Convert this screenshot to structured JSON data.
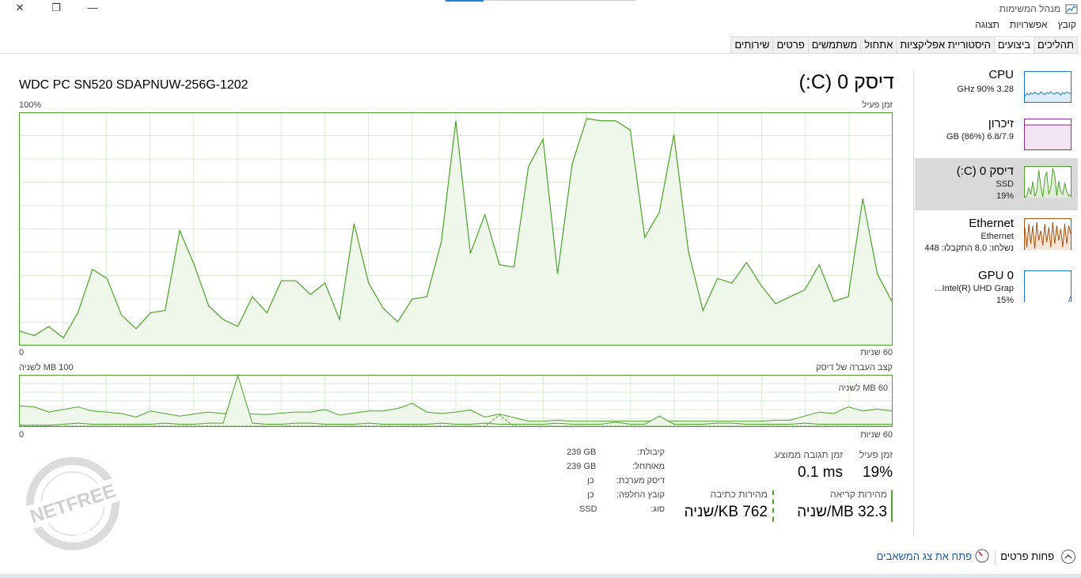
{
  "window": {
    "title": "מנהל המשימות",
    "controls": {
      "minimize": "—",
      "restore": "❐",
      "close": "✕"
    }
  },
  "menu": [
    "קובץ",
    "אפשרויות",
    "תצוגה"
  ],
  "tabs": [
    "תהליכים",
    "ביצועים",
    "היסטוריית אפליקציות",
    "אתחול",
    "משתמשים",
    "פרטים",
    "שירותים"
  ],
  "active_tab": "ביצועים",
  "sidebar": {
    "items": [
      {
        "title": "CPU",
        "sub1": "3.28 GHz  90%",
        "color": "#1a7bbf",
        "fill": "#dcecf8",
        "border": "#1a7bbf",
        "trace": [
          20,
          30,
          25,
          32,
          28,
          34,
          30,
          27,
          35,
          31,
          26,
          33,
          29,
          36,
          30,
          28,
          34,
          31,
          25,
          33,
          29,
          35,
          32,
          30
        ]
      },
      {
        "title": "זיכרון",
        "sub1": "6.8/7.9 GB (86%)",
        "color": "#8b2a8f",
        "fill": "#f2e4f2",
        "border": "#8b2a8f",
        "trace": [
          86,
          86,
          86,
          86,
          86,
          86,
          86,
          86,
          86,
          86,
          86,
          86,
          86,
          86,
          86,
          86,
          86,
          86,
          86,
          86,
          86,
          86,
          86,
          86
        ]
      },
      {
        "title": "דיסק 0 (C:)",
        "sub1": "SSD",
        "sub2": "19%",
        "color": "#4ca22a",
        "fill": "#dff0d6",
        "border": "#4ca22a",
        "trace": [
          10,
          15,
          40,
          20,
          60,
          15,
          30,
          95,
          45,
          12,
          70,
          90,
          20,
          40,
          100,
          80,
          15,
          60,
          30,
          20,
          55,
          30,
          15,
          19
        ]
      },
      {
        "title": "Ethernet",
        "sub1": "Ethernet",
        "sub2": "נשלחו: 8.0  התקבלו: 448",
        "color": "#a6530f",
        "fill": "#f4e4d6",
        "border": "#a6530f",
        "trace": [
          80,
          20,
          90,
          30,
          85,
          15,
          95,
          40,
          70,
          25,
          90,
          35,
          80,
          20,
          95,
          30,
          85,
          40,
          75,
          20,
          90,
          30,
          85,
          60
        ]
      },
      {
        "title": "GPU 0",
        "sub1": "Intel(R) UHD Grap...",
        "sub2": "15%",
        "color": "#1a7bbf",
        "fill": "#dcecf8",
        "border": "#1a7bbf",
        "trace": [
          5,
          8,
          6,
          10,
          7,
          5,
          9,
          6,
          8,
          7,
          5,
          6,
          9,
          7,
          6,
          8,
          5,
          7,
          6,
          9,
          8,
          6,
          12,
          30
        ]
      }
    ]
  },
  "disk": {
    "header_title": "דיסק 0 (C:)",
    "model": "WDC PC SN520 SDAPNUW-256G-1202",
    "active_time_label": "זמן פעיל",
    "pct_100": "100%",
    "axis_zero": "0",
    "axis_time": "60 שניות",
    "transfer_label": "קצב העברה של דיסק",
    "transfer_max": "100 MB לשניה",
    "transfer_inner": "60 MB לשניה",
    "active_series": [
      6,
      4,
      8,
      3,
      14,
      33,
      29,
      13,
      7,
      14,
      15,
      50,
      35,
      17,
      11,
      8,
      21,
      14,
      28,
      28,
      22,
      27,
      11,
      53,
      27,
      16,
      10,
      20,
      21,
      45,
      98,
      40,
      57,
      35,
      34,
      78,
      90,
      31,
      79,
      99,
      98,
      98,
      94,
      47,
      58,
      92,
      41,
      15,
      29,
      27,
      36,
      26,
      18,
      21,
      24,
      35,
      19,
      21,
      64,
      31,
      19
    ],
    "read_series": [
      40,
      38,
      28,
      33,
      38,
      30,
      28,
      25,
      18,
      30,
      25,
      20,
      24,
      28,
      25,
      28,
      24,
      23,
      26,
      28,
      28,
      33,
      22,
      26,
      30,
      30,
      35,
      45,
      28,
      25,
      28,
      32,
      18,
      24,
      17,
      10,
      10,
      12,
      10,
      10,
      10,
      10,
      10,
      10,
      10,
      10,
      10,
      10,
      10,
      10,
      10,
      10,
      12,
      12,
      20,
      28,
      25,
      38,
      30,
      34,
      30
    ],
    "write_series": [
      2,
      2,
      2,
      4,
      6,
      4,
      4,
      4,
      4,
      4,
      6,
      4,
      4,
      6,
      6,
      100,
      6,
      4,
      4,
      6,
      6,
      4,
      4,
      4,
      6,
      4,
      4,
      4,
      4,
      6,
      4,
      4,
      6,
      4,
      4,
      4,
      4,
      6,
      4,
      4,
      4,
      8,
      4,
      4,
      20,
      4,
      4,
      4,
      6,
      6,
      4,
      4,
      4,
      4,
      6,
      4,
      4,
      4,
      4,
      4,
      4
    ],
    "read_dashed": [
      0,
      0,
      0,
      0,
      0,
      0,
      0,
      0,
      0,
      0,
      0,
      0,
      0,
      0,
      0,
      0,
      0,
      0,
      0,
      0,
      0,
      0,
      0,
      0,
      0,
      0,
      0,
      0,
      0,
      0,
      0,
      0,
      0,
      22,
      0,
      0,
      0,
      0,
      0,
      0,
      0,
      0,
      0,
      0,
      0,
      0,
      0,
      0,
      0,
      0,
      0,
      0,
      0,
      0,
      0,
      0,
      0,
      0,
      0,
      0,
      0
    ],
    "stats": {
      "active_time_label": "זמן פעיל",
      "active_time_value": "19%",
      "resp_label": "זמן תגובה ממוצע",
      "resp_value": "0.1 ms",
      "read_label": "מהירות קריאה",
      "read_value": "32.3 MB/שניה",
      "write_label": "מהירות כתיבה",
      "write_value": "762 KB/שניה",
      "props": [
        {
          "label": "קיבולת:",
          "value": "239 GB"
        },
        {
          "label": "מאותחל:",
          "value": "239 GB"
        },
        {
          "label": "דיסק מערכת:",
          "value": "כן"
        },
        {
          "label": "קובץ החלפה:",
          "value": "כן"
        },
        {
          "label": "סוג:",
          "value": "SSD"
        }
      ]
    }
  },
  "watermark": {
    "top": "מחושב",
    "mid": "NETFREE",
    "bot": "מוגן"
  },
  "footer": {
    "fewer_details": "פחות פרטים",
    "open_monitor": "פתח את צג המשאבים"
  },
  "colors": {
    "disk_line": "#4ca22a",
    "disk_fill": "#eef7e9",
    "grid": "#d8ecd0",
    "accent_link": "#1c5aa8"
  }
}
